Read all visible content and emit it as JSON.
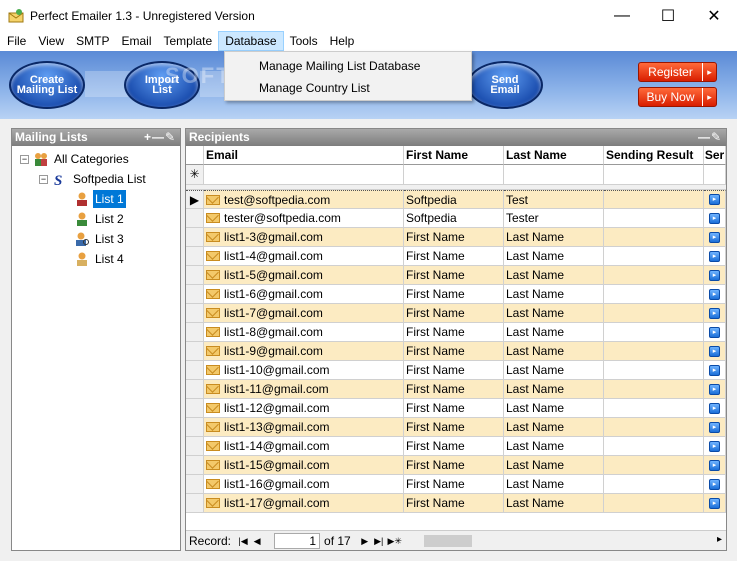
{
  "window": {
    "title": "Perfect Emailer 1.3 - Unregistered Version",
    "minimize_glyph": "—",
    "maximize_glyph": "☐",
    "close_glyph": "✕"
  },
  "menu": [
    "File",
    "View",
    "SMTP",
    "Email",
    "Template",
    "Database",
    "Tools",
    "Help"
  ],
  "database_menu": [
    "Manage Mailing List Database",
    "Manage Country List"
  ],
  "toolbar": {
    "create_label": "Create\nMailing List",
    "import_label": "Import\nList",
    "send_label": "Send\nEmail",
    "watermark": "SOFTPEDIA",
    "register_label": "Register",
    "buynow_label": "Buy Now",
    "chevron": "▸"
  },
  "left_panel": {
    "title": "Mailing Lists",
    "tools": "+—✎",
    "tree": {
      "root": "All Categories",
      "group": "Softpedia List",
      "items": [
        "List 1",
        "List 2",
        "List 3",
        "List 4"
      ]
    }
  },
  "right_panel": {
    "title": "Recipients",
    "tools": "—✎",
    "columns": [
      "Email",
      "First Name",
      "Last Name",
      "Sending Result",
      "Ser"
    ],
    "new_row_marker": "✳",
    "current_marker": "▶",
    "rows": [
      {
        "email": "test@softpedia.com",
        "first": "Softpedia",
        "last": "Test"
      },
      {
        "email": "tester@softpedia.com",
        "first": "Softpedia",
        "last": "Tester"
      },
      {
        "email": "list1-3@gmail.com",
        "first": "First Name",
        "last": "Last Name"
      },
      {
        "email": "list1-4@gmail.com",
        "first": "First Name",
        "last": "Last Name"
      },
      {
        "email": "list1-5@gmail.com",
        "first": "First Name",
        "last": "Last Name"
      },
      {
        "email": "list1-6@gmail.com",
        "first": "First Name",
        "last": "Last Name"
      },
      {
        "email": "list1-7@gmail.com",
        "first": "First Name",
        "last": "Last Name"
      },
      {
        "email": "list1-8@gmail.com",
        "first": "First Name",
        "last": "Last Name"
      },
      {
        "email": "list1-9@gmail.com",
        "first": "First Name",
        "last": "Last Name"
      },
      {
        "email": "list1-10@gmail.com",
        "first": "First Name",
        "last": "Last Name"
      },
      {
        "email": "list1-11@gmail.com",
        "first": "First Name",
        "last": "Last Name"
      },
      {
        "email": "list1-12@gmail.com",
        "first": "First Name",
        "last": "Last Name"
      },
      {
        "email": "list1-13@gmail.com",
        "first": "First Name",
        "last": "Last Name"
      },
      {
        "email": "list1-14@gmail.com",
        "first": "First Name",
        "last": "Last Name"
      },
      {
        "email": "list1-15@gmail.com",
        "first": "First Name",
        "last": "Last Name"
      },
      {
        "email": "list1-16@gmail.com",
        "first": "First Name",
        "last": "Last Name"
      },
      {
        "email": "list1-17@gmail.com",
        "first": "First Name",
        "last": "Last Name"
      }
    ],
    "navigator": {
      "label": "Record:",
      "current": "1",
      "of_text": "of 17",
      "first_glyph": "|◀",
      "prev_glyph": "◀",
      "next_glyph": "▶",
      "last_glyph": "▶|",
      "new_glyph": "▶✳",
      "scroll_right": "▸"
    }
  },
  "colors": {
    "alt_row": "#fcebc2",
    "selection": "#0078d7",
    "menu_active": "#cce8ff"
  }
}
